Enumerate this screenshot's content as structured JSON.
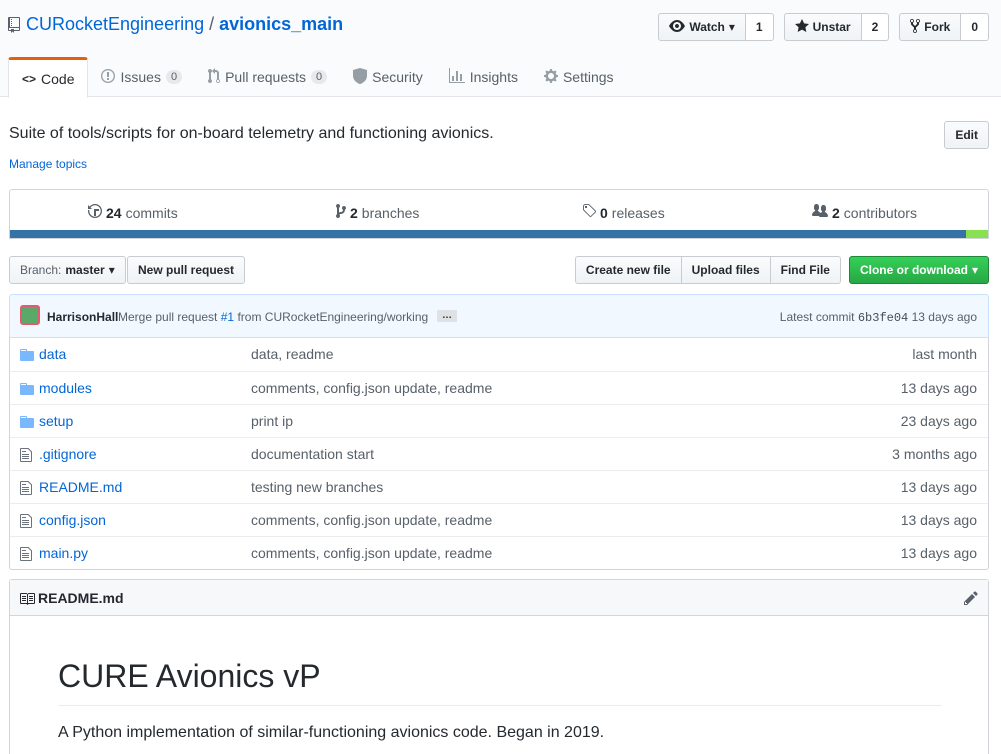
{
  "repo": {
    "owner": "CURocketEngineering",
    "separator": "/",
    "name": "avionics_main"
  },
  "actions": {
    "watch_label": "Watch",
    "watch_count": "1",
    "star_label": "Unstar",
    "star_count": "2",
    "fork_label": "Fork",
    "fork_count": "0"
  },
  "tabs": [
    {
      "label": "Code"
    },
    {
      "label": "Issues",
      "count": "0"
    },
    {
      "label": "Pull requests",
      "count": "0"
    },
    {
      "label": "Security"
    },
    {
      "label": "Insights"
    },
    {
      "label": "Settings"
    }
  ],
  "about": {
    "description": "Suite of tools/scripts for on-board telemetry and functioning avionics.",
    "edit_label": "Edit",
    "topics_link": "Manage topics"
  },
  "summary": {
    "commits_count": "24",
    "commits_label": "commits",
    "branches_count": "2",
    "branches_label": "branches",
    "releases_count": "0",
    "releases_label": "releases",
    "contributors_count": "2",
    "contributors_label": "contributors"
  },
  "languages": [
    {
      "color": "#3572A5",
      "percent": 97.8
    },
    {
      "color": "#89e051",
      "percent": 2.2
    }
  ],
  "file_nav": {
    "branch_prefix": "Branch:",
    "branch": "master",
    "new_pr": "New pull request",
    "create_file": "Create new file",
    "upload_files": "Upload files",
    "find_file": "Find File",
    "clone": "Clone or download"
  },
  "commit": {
    "author": "HarrisonHall",
    "message_pre": "Merge pull request",
    "pr_link": "#1",
    "message_post": "from CURocketEngineering/working",
    "ellipsis": "…",
    "latest_label": "Latest commit",
    "sha": "6b3fe04",
    "age": "13 days ago"
  },
  "files": [
    {
      "type": "folder",
      "name": "data",
      "message": "data, readme",
      "age": "last month"
    },
    {
      "type": "folder",
      "name": "modules",
      "message": "comments, config.json update, readme",
      "age": "13 days ago"
    },
    {
      "type": "folder",
      "name": "setup",
      "message": "print ip",
      "age": "23 days ago"
    },
    {
      "type": "file",
      "name": ".gitignore",
      "message": "documentation start",
      "age": "3 months ago"
    },
    {
      "type": "file",
      "name": "README.md",
      "message": "testing new branches",
      "age": "13 days ago"
    },
    {
      "type": "file",
      "name": "config.json",
      "message": "comments, config.json update, readme",
      "age": "13 days ago"
    },
    {
      "type": "file",
      "name": "main.py",
      "message": "comments, config.json update, readme",
      "age": "13 days ago"
    }
  ],
  "readme": {
    "filename": "README.md",
    "heading": "CURE Avionics vP",
    "paragraph": "A Python implementation of similar-functioning avionics code. Began in 2019."
  }
}
